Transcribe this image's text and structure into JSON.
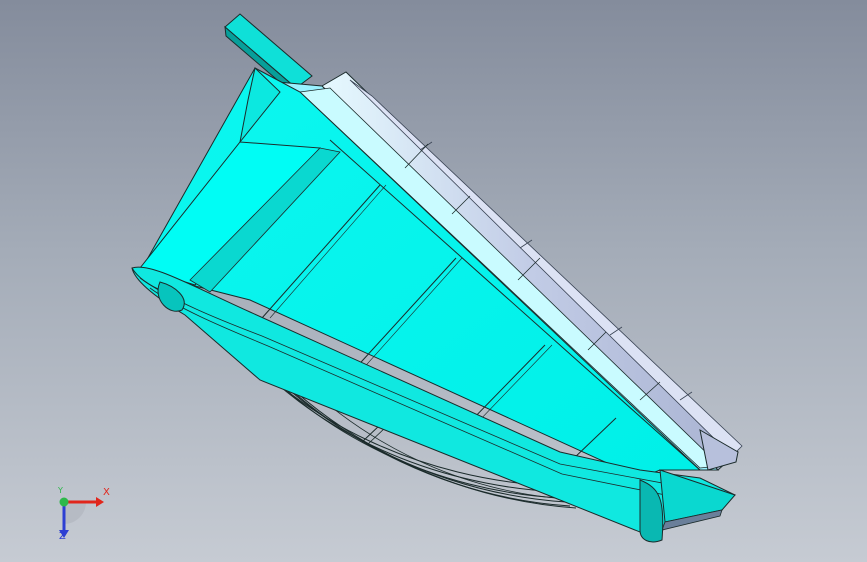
{
  "colors": {
    "body": "#00fdf5",
    "body_shade": "#0ad8d0",
    "body_dark": "#009f9b",
    "flange_steel": "#c4cbe3",
    "flange_light": "#d8f8ff",
    "edge": "#1b2b2b",
    "axis_x": "#e1261c",
    "axis_y": "#2db84a",
    "axis_z": "#2d3fd3"
  },
  "view_triad": {
    "x_label": "X",
    "y_label": "Y",
    "z_label": "Z"
  }
}
